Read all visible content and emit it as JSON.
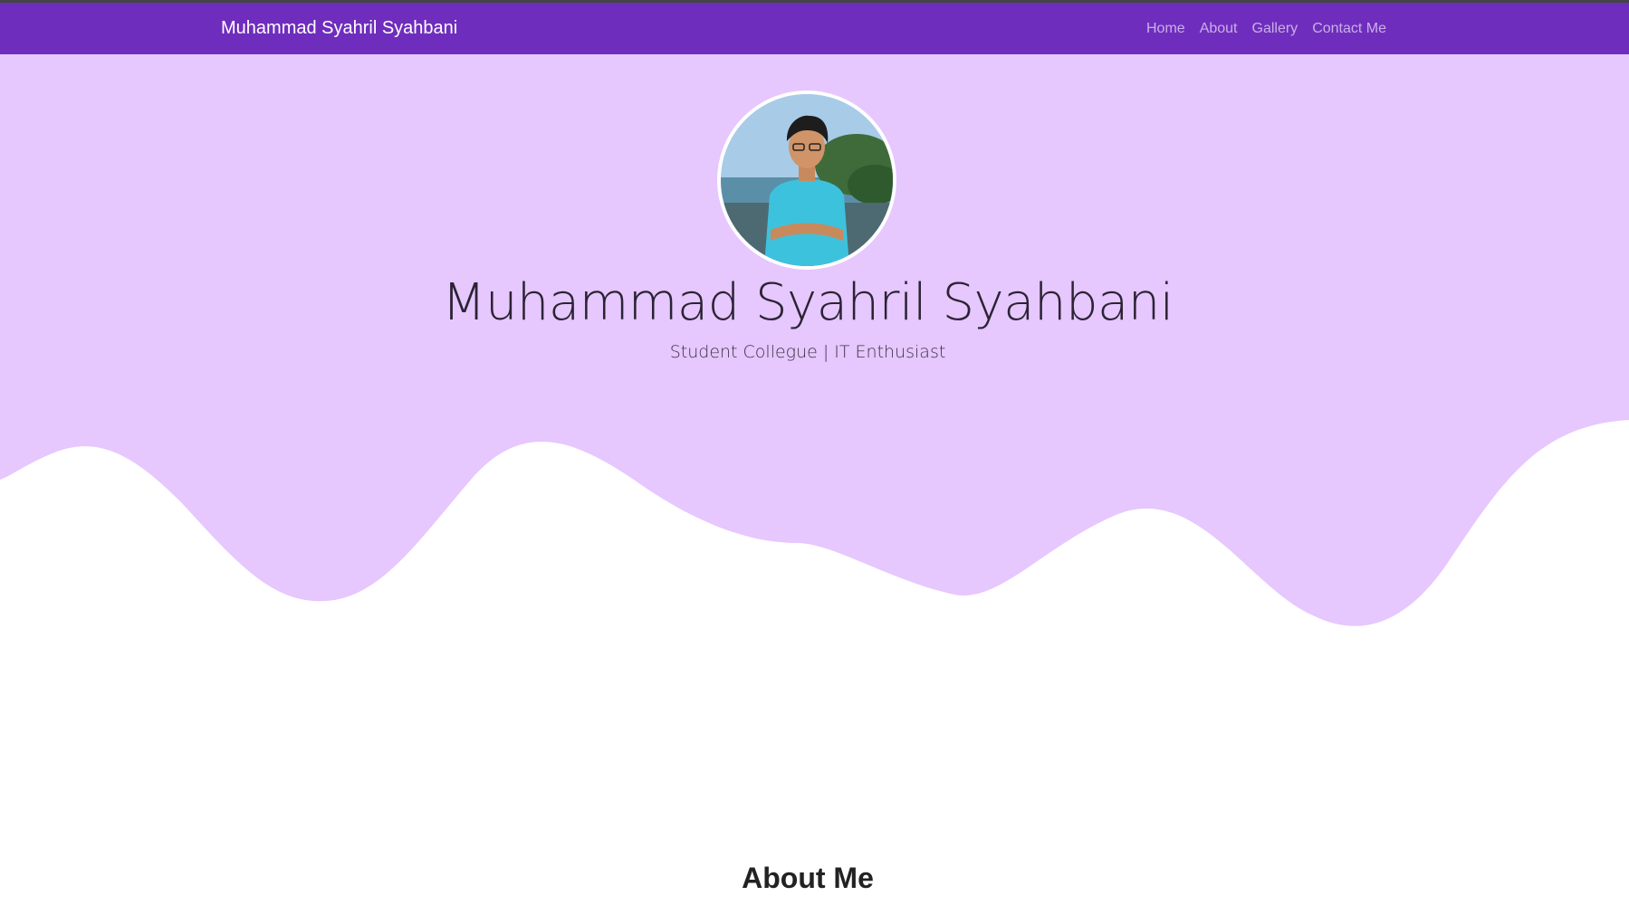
{
  "colors": {
    "navbar": "#6f2dbd",
    "hero_background": "#e6c7fe",
    "page_background": "#ffffff"
  },
  "navbar": {
    "brand": "Muhammad Syahril Syahbani",
    "links": [
      {
        "label": "Home"
      },
      {
        "label": "About"
      },
      {
        "label": "Gallery"
      },
      {
        "label": "Contact Me"
      }
    ]
  },
  "hero": {
    "avatar_icon": "profile-photo",
    "title": "Muhammad Syahril Syahbani",
    "subtitle": "Student Collegue | IT Enthusiast"
  },
  "about": {
    "heading": "About Me"
  }
}
